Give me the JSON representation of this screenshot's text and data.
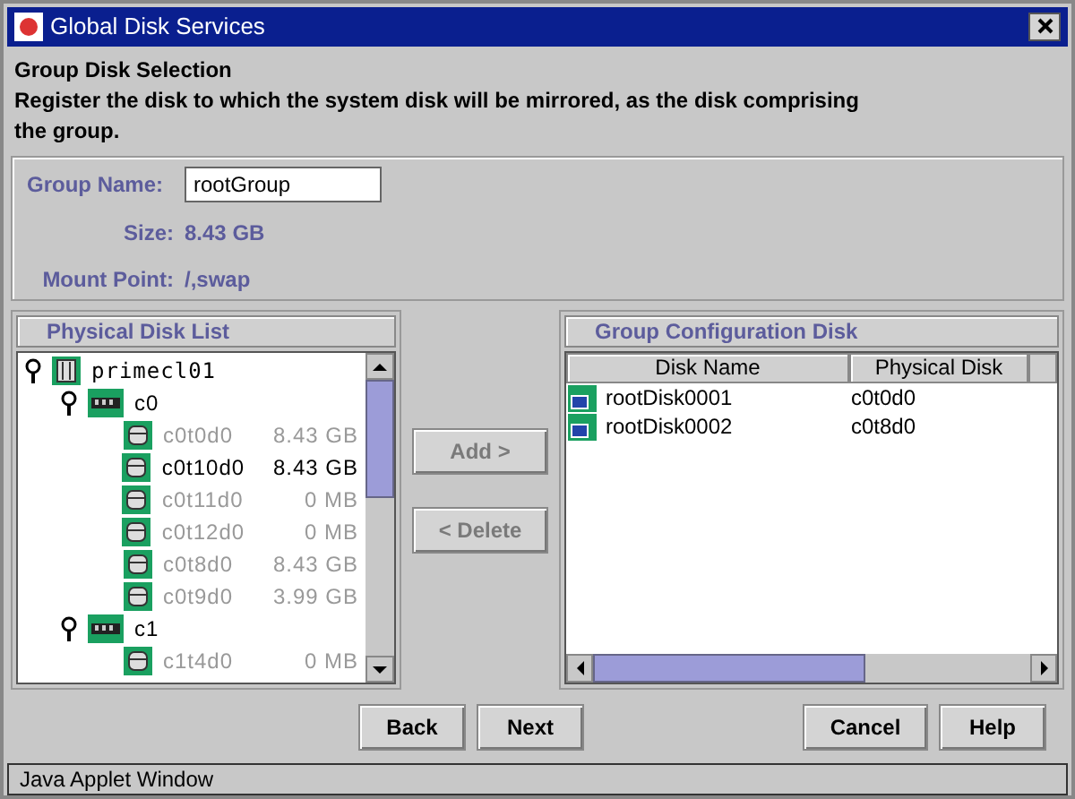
{
  "window": {
    "title": "Global Disk Services"
  },
  "heading": "Group Disk Selection",
  "description": "Register the disk to which the system disk will be mirrored, as the disk comprising the group.",
  "group": {
    "name_label": "Group Name:",
    "name_value": "rootGroup",
    "size_label": "Size:",
    "size_value": "8.43 GB",
    "mount_label": "Mount Point:",
    "mount_value": "/,swap"
  },
  "physical_disk_list": {
    "title": "Physical Disk List",
    "tree": [
      {
        "kind": "host",
        "label": "primecl01",
        "expanded": true,
        "children": [
          {
            "kind": "controller",
            "label": "c0",
            "expanded": true,
            "children": [
              {
                "kind": "disk",
                "label": "c0t0d0",
                "size": "8.43 GB",
                "disabled": true
              },
              {
                "kind": "disk",
                "label": "c0t10d0",
                "size": "8.43 GB",
                "disabled": false
              },
              {
                "kind": "disk",
                "label": "c0t11d0",
                "size": "0 MB",
                "disabled": true
              },
              {
                "kind": "disk",
                "label": "c0t12d0",
                "size": "0 MB",
                "disabled": true
              },
              {
                "kind": "disk",
                "label": "c0t8d0",
                "size": "8.43 GB",
                "disabled": true
              },
              {
                "kind": "disk",
                "label": "c0t9d0",
                "size": "3.99 GB",
                "disabled": true
              }
            ]
          },
          {
            "kind": "controller",
            "label": "c1",
            "expanded": true,
            "children": [
              {
                "kind": "disk",
                "label": "c1t4d0",
                "size": "0 MB",
                "disabled": true
              }
            ]
          }
        ]
      }
    ]
  },
  "move_buttons": [
    {
      "label": "Add >",
      "disabled": true
    },
    {
      "label": "< Delete",
      "disabled": true
    }
  ],
  "group_configuration": {
    "title": "Group Configuration Disk",
    "columns": [
      "Disk Name",
      "Physical Disk"
    ],
    "rows": [
      {
        "disk_name": "rootDisk0001",
        "physical_disk": "c0t0d0"
      },
      {
        "disk_name": "rootDisk0002",
        "physical_disk": "c0t8d0"
      }
    ]
  },
  "buttons": [
    "Back",
    "Next",
    "Cancel",
    "Help"
  ],
  "status_bar": "Java Applet Window"
}
